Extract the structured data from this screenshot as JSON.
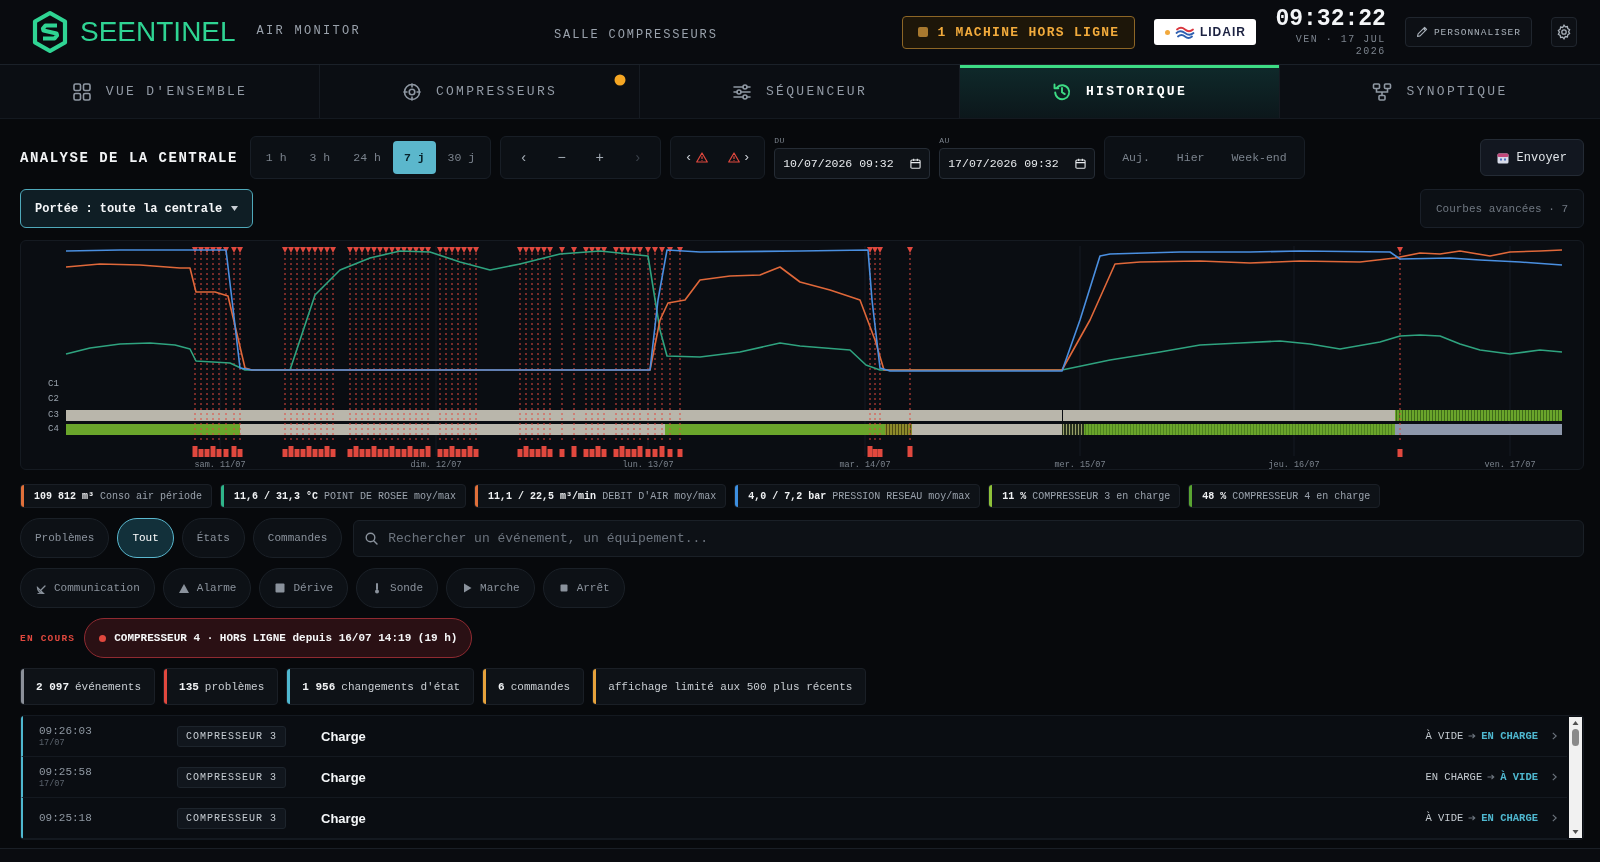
{
  "header": {
    "brand": "SEENTINEL",
    "product": "AIR MONITOR",
    "site": "SALLE COMPRESSEURS",
    "alert": "1 MACHINE HORS LIGNE",
    "partner": "LIDAIR",
    "time": "09:32:22",
    "date": "VEN · 17 JUL 2026",
    "customize_button": "PERSONNALISER"
  },
  "tabs": [
    {
      "label": "VUE D'ENSEMBLE",
      "selected": false,
      "alert": false
    },
    {
      "label": "COMPRESSEURS",
      "selected": false,
      "alert": true
    },
    {
      "label": "SÉQUENCEUR",
      "selected": false,
      "alert": false
    },
    {
      "label": "HISTORIQUE",
      "selected": true,
      "alert": false
    },
    {
      "label": "SYNOPTIQUE",
      "selected": false,
      "alert": false
    }
  ],
  "toolbar": {
    "title": "ANALYSE DE LA CENTRALE",
    "ranges": [
      {
        "label": "1 h",
        "selected": false
      },
      {
        "label": "3 h",
        "selected": false
      },
      {
        "label": "24 h",
        "selected": false
      },
      {
        "label": "7 j",
        "selected": true
      },
      {
        "label": "30 j",
        "selected": false
      }
    ],
    "nav": [
      {
        "label": "‹",
        "disabled": false
      },
      {
        "label": "−",
        "disabled": false
      },
      {
        "label": "+",
        "disabled": false
      },
      {
        "label": "›",
        "disabled": true
      }
    ],
    "alarm_nav": [
      {
        "label": "‹"
      },
      {
        "label": "›"
      }
    ],
    "from": {
      "label": "DU",
      "value": "10/07/2026 09:32"
    },
    "to": {
      "label": "AU",
      "value": "17/07/2026 09:32"
    },
    "quick_ranges": [
      "Auj.",
      "Hier",
      "Week-end"
    ],
    "send_button": "Envoyer",
    "scope_button": "Portée : toute la centrale",
    "advanced_button": "Courbes avancées · 7"
  },
  "chart": {
    "rows": [
      "C1",
      "C2",
      "C3",
      "C4"
    ],
    "dates": [
      "sam. 11/07",
      "dim. 12/07",
      "lun. 13/07",
      "mar. 14/07",
      "mer. 15/07",
      "jeu. 16/07",
      "ven. 17/07"
    ]
  },
  "stats": [
    {
      "value": "109 812 m³",
      "label": "Conso air période",
      "color": "#e0703a"
    },
    {
      "value": "11,6 / 31,3 °C",
      "label": "POINT DE ROSEE moy/max",
      "color": "#2fb58a"
    },
    {
      "value": "11,1 / 22,5 m³/min",
      "label": "DEBIT D'AIR moy/max",
      "color": "#e0703a"
    },
    {
      "value": "4,0 / 7,2 bar",
      "label": "PRESSION RESEAU moy/max",
      "color": "#3d8fe0"
    },
    {
      "value": "11 %",
      "label": "COMPRESSEUR 3 en charge",
      "color": "#8fc23a"
    },
    {
      "value": "48 %",
      "label": "COMPRESSEUR 4 en charge",
      "color": "#5aa532"
    }
  ],
  "filters": {
    "categories": [
      {
        "label": "Problèmes",
        "selected": false
      },
      {
        "label": "Tout",
        "selected": true
      },
      {
        "label": "États",
        "selected": false
      },
      {
        "label": "Commandes",
        "selected": false
      }
    ],
    "search": {
      "placeholder": "Rechercher un événement, un équipement..."
    },
    "types": [
      {
        "label": "Communication",
        "selected": false
      },
      {
        "label": "Alarme",
        "selected": false
      },
      {
        "label": "Dérive",
        "selected": false
      },
      {
        "label": "Sonde",
        "selected": false
      },
      {
        "label": "Marche",
        "selected": false
      },
      {
        "label": "Arrêt",
        "selected": false
      }
    ]
  },
  "ongoing": {
    "label": "EN COURS",
    "items": [
      "COMPRESSEUR 4 · HORS LIGNE depuis 16/07 14:19 (19 h)"
    ]
  },
  "counts": [
    {
      "value": "2 097",
      "label": "événements",
      "color": "#8b9099"
    },
    {
      "value": "135",
      "label": "problèmes",
      "color": "#e0483e"
    },
    {
      "value": "1 956",
      "label": "changements d'état",
      "color": "#4fb8d0"
    },
    {
      "value": "6",
      "label": "commandes",
      "color": "#e6a23c"
    },
    {
      "label": "affichage limité aux 500 plus récents",
      "color": "#e6a23c"
    }
  ],
  "events": [
    {
      "time": "09:26:03",
      "date": "17/07",
      "equipment": "COMPRESSEUR 3",
      "title": "Charge",
      "from": "À VIDE",
      "to": "EN CHARGE"
    },
    {
      "time": "09:25:58",
      "date": "17/07",
      "equipment": "COMPRESSEUR 3",
      "title": "Charge",
      "from": "EN CHARGE",
      "to": "À VIDE"
    },
    {
      "time": "09:25:18",
      "equipment": "COMPRESSEUR 3",
      "title": "Charge",
      "from": "À VIDE",
      "to": "EN CHARGE"
    }
  ]
}
